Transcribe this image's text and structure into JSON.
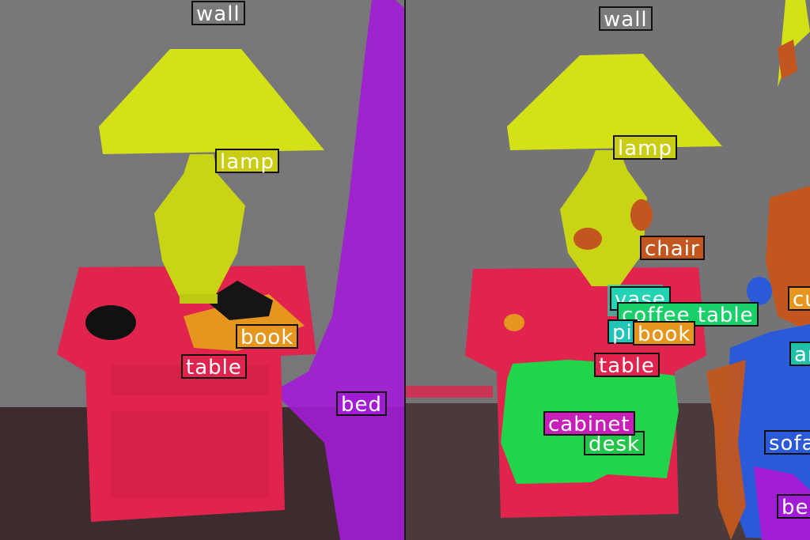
{
  "left_panel": {
    "labels": [
      {
        "text": "wall",
        "color": "#7a7a7a"
      },
      {
        "text": "lamp",
        "color": "#c9cd14"
      },
      {
        "text": "book",
        "color": "#e6961e"
      },
      {
        "text": "table",
        "color": "#e0244e"
      },
      {
        "text": "bed",
        "color": "#a21cd6"
      }
    ]
  },
  "right_panel": {
    "labels": [
      {
        "text": "wall",
        "color": "#7a7a7a"
      },
      {
        "text": "lamp",
        "color": "#c9cd14"
      },
      {
        "text": "chair",
        "color": "#c2561e"
      },
      {
        "text": "vase",
        "color": "#22d4b4"
      },
      {
        "text": "coffee table",
        "color": "#18d06a"
      },
      {
        "text": "pi",
        "color": "#22c4b8"
      },
      {
        "text": "book",
        "color": "#e6961e"
      },
      {
        "text": "table",
        "color": "#e0244e"
      },
      {
        "text": "cabinet",
        "color": "#c71fb8"
      },
      {
        "text": "desk",
        "color": "#22c44a"
      },
      {
        "text": "cu",
        "color": "#e6961e"
      },
      {
        "text": "ar",
        "color": "#20c0a8"
      },
      {
        "text": "sofa",
        "color": "#2a5ad8"
      },
      {
        "text": "be",
        "color": "#a21cd6"
      }
    ]
  }
}
